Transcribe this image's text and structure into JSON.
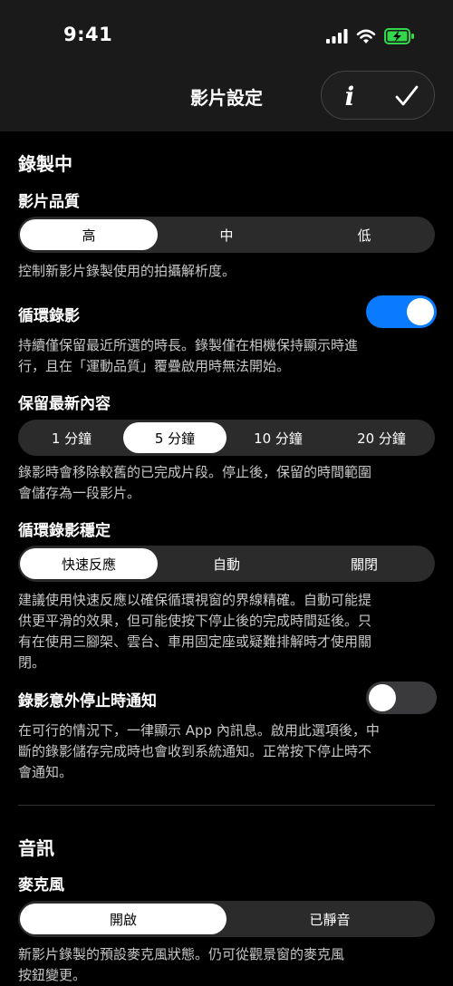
{
  "status": {
    "time": "9:41"
  },
  "nav": {
    "title": "影片設定",
    "info_label": "i"
  },
  "recording": {
    "title": "錄製中",
    "quality": {
      "label": "影片品質",
      "options": [
        "高",
        "中",
        "低"
      ],
      "selected": "高",
      "desc": "控制新影片錄製使用的拍攝解析度。"
    },
    "loop": {
      "label": "循環錄影",
      "enabled": true,
      "desc_1": "持續僅保留最近所選的時長。錄製僅在相機保持顯示時進",
      "desc_2": "行，且在「運動品質」覆疊啟用時無法開始。"
    },
    "keep_latest": {
      "label": "保留最新內容",
      "options": [
        "1 分鐘",
        "5 分鐘",
        "10 分鐘",
        "20 分鐘"
      ],
      "selected": "5 分鐘",
      "desc_1": "錄影時會移除較舊的已完成片段。停止後，保留的時間範圍",
      "desc_2": "會儲存為一段影片。"
    },
    "stabilization": {
      "label": "循環錄影穩定",
      "options": [
        "快速反應",
        "自動",
        "關閉"
      ],
      "selected": "快速反應",
      "desc_1": "建議使用快速反應以確保循環視窗的界線精確。自動可能提",
      "desc_2": "供更平滑的效果，但可能使按下停止後的完成時間延後。只",
      "desc_3": "有在使用三腳架、雲台、車用固定座或疑難排解時才使用關",
      "desc_4": "閉。"
    },
    "notify": {
      "label": "錄影意外停止時通知",
      "enabled": false,
      "desc_1": "在可行的情況下，一律顯示 App 內訊息。啟用此選項後，中",
      "desc_2": "斷的錄影儲存完成時也會收到系統通知。正常按下停止時不",
      "desc_3": "會通知。"
    }
  },
  "audio": {
    "title": "音訊",
    "mic": {
      "label": "麥克風",
      "options": [
        "開啟",
        "已靜音"
      ],
      "selected": "開啟",
      "desc_1": "新影片錄製的預設麥克風狀態。仍可從觀景窗的麥克風",
      "desc_2": "按鈕變更。"
    }
  },
  "colors": {
    "toggle_on": "#0a7aff",
    "toggle_off": "#3a3a3c",
    "battery": "#32d74b"
  }
}
